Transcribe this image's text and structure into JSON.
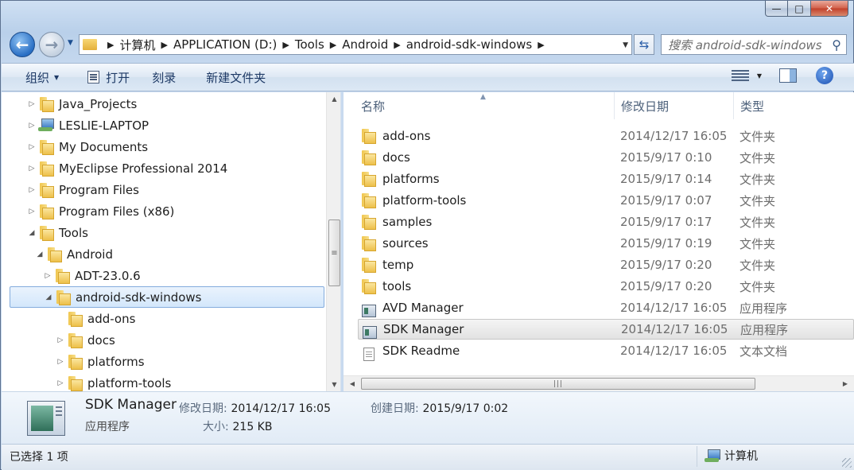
{
  "window": {
    "caption": {
      "minimize": "—",
      "maximize": "□",
      "close": "✕"
    }
  },
  "address_bar": {
    "back": "←",
    "forward": "→",
    "crumbs": [
      "计算机",
      "APPLICATION (D:)",
      "Tools",
      "Android",
      "android-sdk-windows"
    ],
    "refresh": "⇆",
    "search_placeholder": "搜索 android-sdk-windows"
  },
  "toolbar": {
    "organize": "组织",
    "open": "打开",
    "burn": "刻录",
    "new_folder": "新建文件夹",
    "help": "?"
  },
  "nav_tree": [
    {
      "label": "Java_Projects",
      "icon": "folder",
      "indent": 0,
      "expand": "▷"
    },
    {
      "label": "LESLIE-LAPTOP",
      "icon": "computer",
      "indent": 0,
      "expand": "▷"
    },
    {
      "label": "My Documents",
      "icon": "folder",
      "indent": 0,
      "expand": "▷"
    },
    {
      "label": "MyEclipse Professional 2014",
      "icon": "folder",
      "indent": 0,
      "expand": "▷"
    },
    {
      "label": "Program Files",
      "icon": "folder",
      "indent": 0,
      "expand": "▷"
    },
    {
      "label": "Program Files (x86)",
      "icon": "folder",
      "indent": 0,
      "expand": "▷"
    },
    {
      "label": "Tools",
      "icon": "folder",
      "indent": 0,
      "expand": "◢"
    },
    {
      "label": "Android",
      "icon": "folder",
      "indent": 1,
      "expand": "◢"
    },
    {
      "label": "ADT-23.0.6",
      "icon": "folder",
      "indent": 2,
      "expand": "▷"
    },
    {
      "label": "android-sdk-windows",
      "icon": "folder",
      "indent": 2,
      "expand": "◢",
      "selected": true
    },
    {
      "label": "add-ons",
      "icon": "folder",
      "indent": 3,
      "expand": ""
    },
    {
      "label": "docs",
      "icon": "folder",
      "indent": 3,
      "expand": "▷"
    },
    {
      "label": "platforms",
      "icon": "folder",
      "indent": 3,
      "expand": "▷"
    },
    {
      "label": "platform-tools",
      "icon": "folder",
      "indent": 3,
      "expand": "▷"
    }
  ],
  "columns": {
    "name": "名称",
    "date": "修改日期",
    "type": "类型"
  },
  "files": [
    {
      "name": "add-ons",
      "date": "2014/12/17 16:05",
      "type": "文件夹",
      "icon": "folder"
    },
    {
      "name": "docs",
      "date": "2015/9/17 0:10",
      "type": "文件夹",
      "icon": "folder"
    },
    {
      "name": "platforms",
      "date": "2015/9/17 0:14",
      "type": "文件夹",
      "icon": "folder"
    },
    {
      "name": "platform-tools",
      "date": "2015/9/17 0:07",
      "type": "文件夹",
      "icon": "folder"
    },
    {
      "name": "samples",
      "date": "2015/9/17 0:17",
      "type": "文件夹",
      "icon": "folder"
    },
    {
      "name": "sources",
      "date": "2015/9/17 0:19",
      "type": "文件夹",
      "icon": "folder"
    },
    {
      "name": "temp",
      "date": "2015/9/17 0:20",
      "type": "文件夹",
      "icon": "folder"
    },
    {
      "name": "tools",
      "date": "2015/9/17 0:20",
      "type": "文件夹",
      "icon": "folder"
    },
    {
      "name": "AVD Manager",
      "date": "2014/12/17 16:05",
      "type": "应用程序",
      "icon": "app"
    },
    {
      "name": "SDK Manager",
      "date": "2014/12/17 16:05",
      "type": "应用程序",
      "icon": "app",
      "selected": true
    },
    {
      "name": "SDK Readme",
      "date": "2014/12/17 16:05",
      "type": "文本文档",
      "icon": "doc"
    }
  ],
  "details": {
    "name": "SDK Manager",
    "type": "应用程序",
    "modified_label": "修改日期:",
    "modified_value": "2014/12/17 16:05",
    "created_label": "创建日期:",
    "created_value": "2015/9/17 0:02",
    "size_label": "大小:",
    "size_value": "215 KB"
  },
  "status": {
    "selection": "已选择 1 项",
    "location": "计算机"
  }
}
